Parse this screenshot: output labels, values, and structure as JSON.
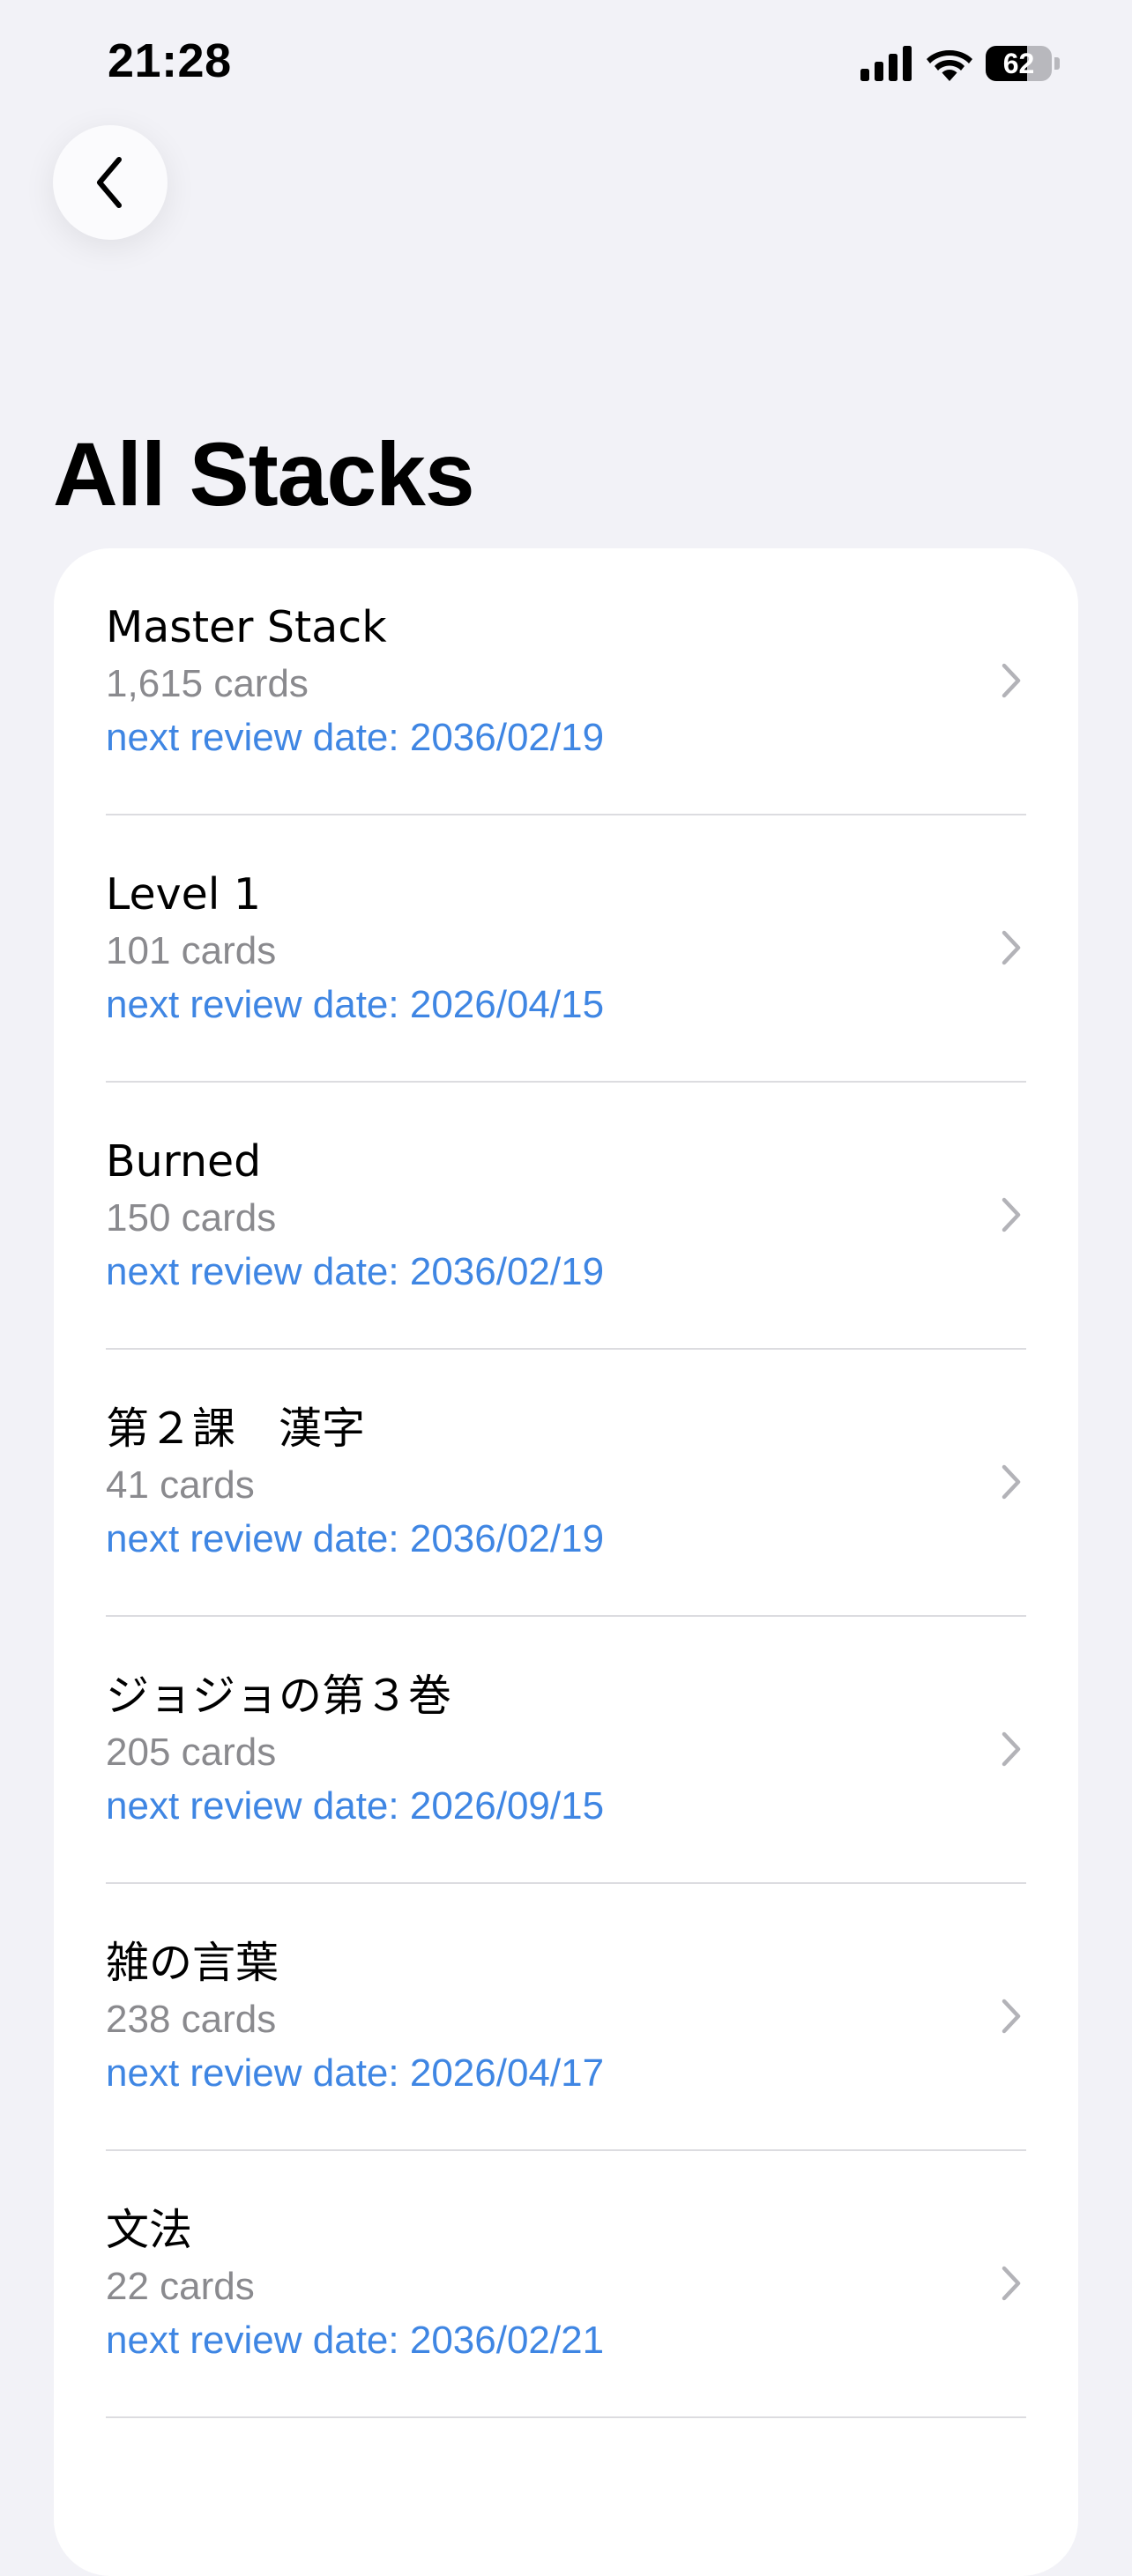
{
  "status_bar": {
    "time": "21:28",
    "battery_level": "62",
    "battery_fraction": 0.62,
    "icons": [
      "signal-icon",
      "wifi-icon",
      "battery-icon"
    ]
  },
  "nav": {
    "back_icon": "chevron-left-icon"
  },
  "page": {
    "title": "All Stacks"
  },
  "stacks": [
    {
      "name": "Master Stack",
      "count": "1,615 cards",
      "review": "next review date: 2036/02/19"
    },
    {
      "name": "Level 1",
      "count": "101 cards",
      "review": "next review date: 2026/04/15"
    },
    {
      "name": "Burned",
      "count": "150 cards",
      "review": "next review date: 2036/02/19"
    },
    {
      "name": "第２課　漢字",
      "count": "41 cards",
      "review": "next review date: 2036/02/19"
    },
    {
      "name": "ジョジョの第３巻",
      "count": "205 cards",
      "review": "next review date: 2026/09/15"
    },
    {
      "name": "雑の言葉",
      "count": "238 cards",
      "review": "next review date: 2026/04/17"
    },
    {
      "name": "文法",
      "count": "22 cards",
      "review": "next review date: 2036/02/21"
    }
  ],
  "colors": {
    "background": "#f2f2f7",
    "card": "#ffffff",
    "accent": "#3f86e3",
    "secondary_text": "#8a8a8e",
    "chevron": "#b3b3b8"
  }
}
